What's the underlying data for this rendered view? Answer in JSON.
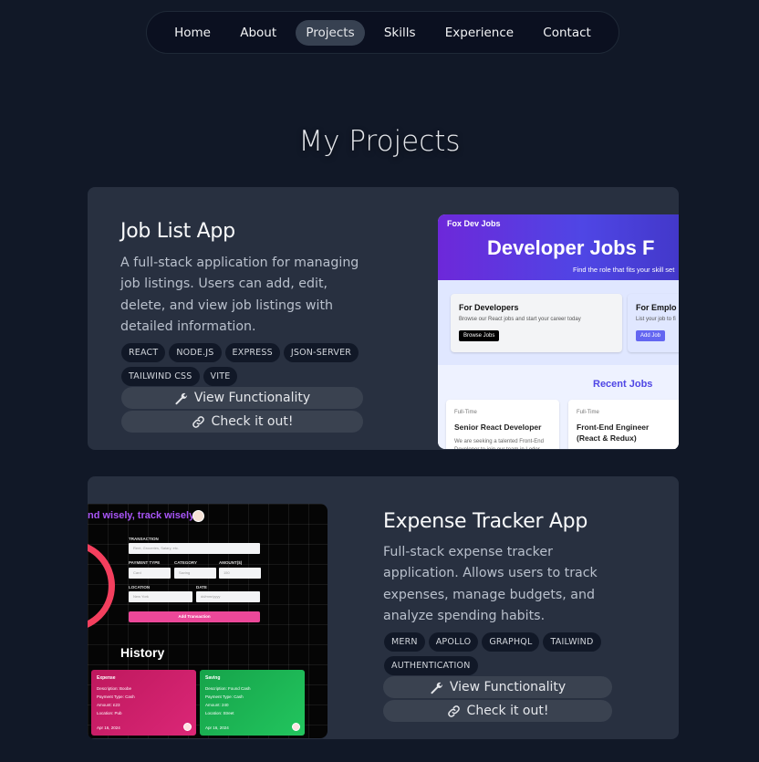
{
  "nav": {
    "items": [
      "Home",
      "About",
      "Projects",
      "Skills",
      "Experience",
      "Contact"
    ],
    "active": "Projects"
  },
  "page_title": "My Projects",
  "projects": [
    {
      "title": "Job List App",
      "description": "A full-stack application for managing job listings. Users can add, edit, delete, and view job listings with detailed information.",
      "tags": [
        "REACT",
        "NODE.JS",
        "EXPRESS",
        "JSON-SERVER",
        "TAILWIND CSS",
        "VITE"
      ],
      "buttons": {
        "functionality": "View Functionality",
        "check": "Check it out!"
      },
      "screenshot": {
        "logo": "Fox Dev Jobs",
        "heading": "Developer Jobs F",
        "subheading": "Find the role that fits your skill set",
        "box1": {
          "title": "For Developers",
          "desc": "Browse our React jobs and start your career today",
          "button": "Browse Jobs"
        },
        "box2": {
          "title": "For Emplo",
          "desc": "List your job to fi",
          "button": "Add Job"
        },
        "recent_title": "Recent Jobs",
        "jobs": [
          {
            "type": "Full-Time",
            "title": "Senior React Developer",
            "desc": "We are seeking a talented Front-End Developer to join our team in Lodor"
          },
          {
            "type": "Full-Time",
            "title": "Front-End Engineer (React & Redux)",
            "desc": ""
          }
        ]
      }
    },
    {
      "title": "Expense Tracker App",
      "description": "Full-stack expense tracker application. Allows users to track expenses, manage budgets, and analyze spending habits.",
      "tags": [
        "MERN",
        "APOLLO",
        "GRAPHQL",
        "TAILWIND",
        "AUTHENTICATION"
      ],
      "buttons": {
        "functionality": "View Functionality",
        "check": "Check it out!"
      },
      "screenshot": {
        "title": "nd wisely, track wisely",
        "labels": {
          "transaction": "TRANSACTION",
          "payment_type": "PAYMENT TYPE",
          "category": "CATEGORY",
          "amount": "AMOUNT($)",
          "location": "LOCATION",
          "date": "DATE"
        },
        "inputs": {
          "transaction": "Rent, Groceries, Salary, etc.",
          "payment_type": "Card",
          "category": "Saving",
          "amount": "150",
          "location": "New York",
          "date": "dd/mm/yyyy"
        },
        "add_button": "Add Transaction",
        "history": "History",
        "cards": [
          {
            "heading": "Expense",
            "lines": [
              "Description: Boobe",
              "Payment Type: Cash",
              "Amount: £23",
              "Location: Pub"
            ],
            "date": "Apr 16, 2024"
          },
          {
            "heading": "Saving",
            "lines": [
              "Description: Found Cash",
              "Payment Type: Cash",
              "Amount: 240",
              "Location: Street"
            ],
            "date": "Apr 16, 2024"
          }
        ]
      }
    }
  ],
  "colors": {
    "background": "#111827",
    "card": "#283040",
    "tag": "#111827",
    "button": "#3a4250"
  }
}
